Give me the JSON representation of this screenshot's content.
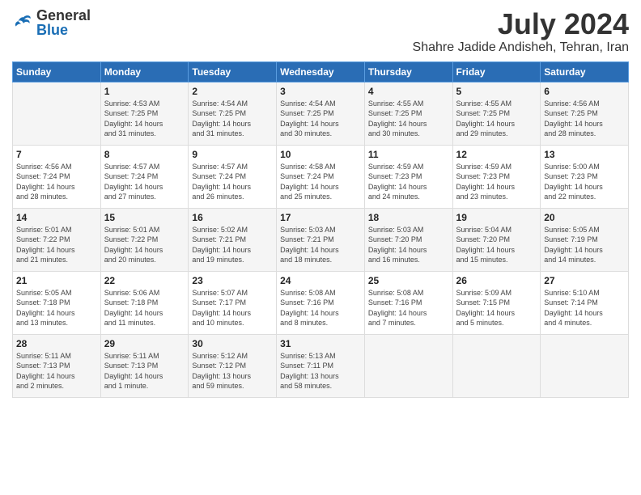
{
  "header": {
    "logo_line1": "General",
    "logo_line2": "Blue",
    "month_title": "July 2024",
    "subtitle": "Shahre Jadide Andisheh, Tehran, Iran"
  },
  "days_of_week": [
    "Sunday",
    "Monday",
    "Tuesday",
    "Wednesday",
    "Thursday",
    "Friday",
    "Saturday"
  ],
  "weeks": [
    [
      {
        "day": "",
        "info": ""
      },
      {
        "day": "1",
        "info": "Sunrise: 4:53 AM\nSunset: 7:25 PM\nDaylight: 14 hours\nand 31 minutes."
      },
      {
        "day": "2",
        "info": "Sunrise: 4:54 AM\nSunset: 7:25 PM\nDaylight: 14 hours\nand 31 minutes."
      },
      {
        "day": "3",
        "info": "Sunrise: 4:54 AM\nSunset: 7:25 PM\nDaylight: 14 hours\nand 30 minutes."
      },
      {
        "day": "4",
        "info": "Sunrise: 4:55 AM\nSunset: 7:25 PM\nDaylight: 14 hours\nand 30 minutes."
      },
      {
        "day": "5",
        "info": "Sunrise: 4:55 AM\nSunset: 7:25 PM\nDaylight: 14 hours\nand 29 minutes."
      },
      {
        "day": "6",
        "info": "Sunrise: 4:56 AM\nSunset: 7:25 PM\nDaylight: 14 hours\nand 28 minutes."
      }
    ],
    [
      {
        "day": "7",
        "info": "Sunrise: 4:56 AM\nSunset: 7:24 PM\nDaylight: 14 hours\nand 28 minutes."
      },
      {
        "day": "8",
        "info": "Sunrise: 4:57 AM\nSunset: 7:24 PM\nDaylight: 14 hours\nand 27 minutes."
      },
      {
        "day": "9",
        "info": "Sunrise: 4:57 AM\nSunset: 7:24 PM\nDaylight: 14 hours\nand 26 minutes."
      },
      {
        "day": "10",
        "info": "Sunrise: 4:58 AM\nSunset: 7:24 PM\nDaylight: 14 hours\nand 25 minutes."
      },
      {
        "day": "11",
        "info": "Sunrise: 4:59 AM\nSunset: 7:23 PM\nDaylight: 14 hours\nand 24 minutes."
      },
      {
        "day": "12",
        "info": "Sunrise: 4:59 AM\nSunset: 7:23 PM\nDaylight: 14 hours\nand 23 minutes."
      },
      {
        "day": "13",
        "info": "Sunrise: 5:00 AM\nSunset: 7:23 PM\nDaylight: 14 hours\nand 22 minutes."
      }
    ],
    [
      {
        "day": "14",
        "info": "Sunrise: 5:01 AM\nSunset: 7:22 PM\nDaylight: 14 hours\nand 21 minutes."
      },
      {
        "day": "15",
        "info": "Sunrise: 5:01 AM\nSunset: 7:22 PM\nDaylight: 14 hours\nand 20 minutes."
      },
      {
        "day": "16",
        "info": "Sunrise: 5:02 AM\nSunset: 7:21 PM\nDaylight: 14 hours\nand 19 minutes."
      },
      {
        "day": "17",
        "info": "Sunrise: 5:03 AM\nSunset: 7:21 PM\nDaylight: 14 hours\nand 18 minutes."
      },
      {
        "day": "18",
        "info": "Sunrise: 5:03 AM\nSunset: 7:20 PM\nDaylight: 14 hours\nand 16 minutes."
      },
      {
        "day": "19",
        "info": "Sunrise: 5:04 AM\nSunset: 7:20 PM\nDaylight: 14 hours\nand 15 minutes."
      },
      {
        "day": "20",
        "info": "Sunrise: 5:05 AM\nSunset: 7:19 PM\nDaylight: 14 hours\nand 14 minutes."
      }
    ],
    [
      {
        "day": "21",
        "info": "Sunrise: 5:05 AM\nSunset: 7:18 PM\nDaylight: 14 hours\nand 13 minutes."
      },
      {
        "day": "22",
        "info": "Sunrise: 5:06 AM\nSunset: 7:18 PM\nDaylight: 14 hours\nand 11 minutes."
      },
      {
        "day": "23",
        "info": "Sunrise: 5:07 AM\nSunset: 7:17 PM\nDaylight: 14 hours\nand 10 minutes."
      },
      {
        "day": "24",
        "info": "Sunrise: 5:08 AM\nSunset: 7:16 PM\nDaylight: 14 hours\nand 8 minutes."
      },
      {
        "day": "25",
        "info": "Sunrise: 5:08 AM\nSunset: 7:16 PM\nDaylight: 14 hours\nand 7 minutes."
      },
      {
        "day": "26",
        "info": "Sunrise: 5:09 AM\nSunset: 7:15 PM\nDaylight: 14 hours\nand 5 minutes."
      },
      {
        "day": "27",
        "info": "Sunrise: 5:10 AM\nSunset: 7:14 PM\nDaylight: 14 hours\nand 4 minutes."
      }
    ],
    [
      {
        "day": "28",
        "info": "Sunrise: 5:11 AM\nSunset: 7:13 PM\nDaylight: 14 hours\nand 2 minutes."
      },
      {
        "day": "29",
        "info": "Sunrise: 5:11 AM\nSunset: 7:13 PM\nDaylight: 14 hours\nand 1 minute."
      },
      {
        "day": "30",
        "info": "Sunrise: 5:12 AM\nSunset: 7:12 PM\nDaylight: 13 hours\nand 59 minutes."
      },
      {
        "day": "31",
        "info": "Sunrise: 5:13 AM\nSunset: 7:11 PM\nDaylight: 13 hours\nand 58 minutes."
      },
      {
        "day": "",
        "info": ""
      },
      {
        "day": "",
        "info": ""
      },
      {
        "day": "",
        "info": ""
      }
    ]
  ]
}
